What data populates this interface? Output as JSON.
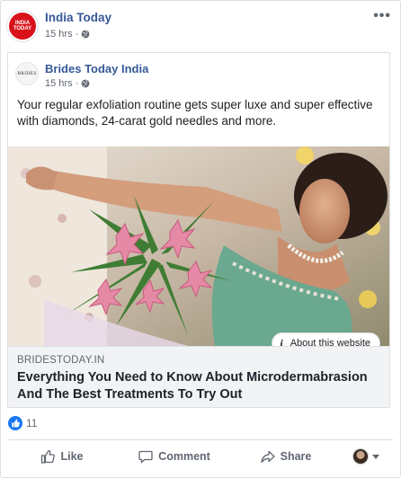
{
  "post": {
    "page_name": "India Today",
    "avatar_text": "INDIA TODAY",
    "time": "15 hrs",
    "more_label": "•••",
    "audience_icon": "globe-icon"
  },
  "shared": {
    "page_name": "Brides Today India",
    "avatar_text": "BRIDES",
    "time": "15 hrs",
    "audience_icon": "globe-icon",
    "text": "Your regular exfoliation routine gets super luxe and super effective with diamonds, 24-carat gold needles and more.",
    "about_label": "About this website",
    "about_icon": "info-icon",
    "link": {
      "domain": "BRIDESTODAY.IN",
      "headline": "Everything You Need to Know About Microdermabrasion And The Best Treatments To Try Out"
    }
  },
  "reactions": {
    "icon": "thumbs-up-icon",
    "count": "11"
  },
  "actions": {
    "like": "Like",
    "comment": "Comment",
    "share": "Share"
  },
  "colors": {
    "link_blue": "#385898",
    "like_blue": "#1877f2",
    "brand_red": "#d8111a",
    "muted": "#606770"
  }
}
